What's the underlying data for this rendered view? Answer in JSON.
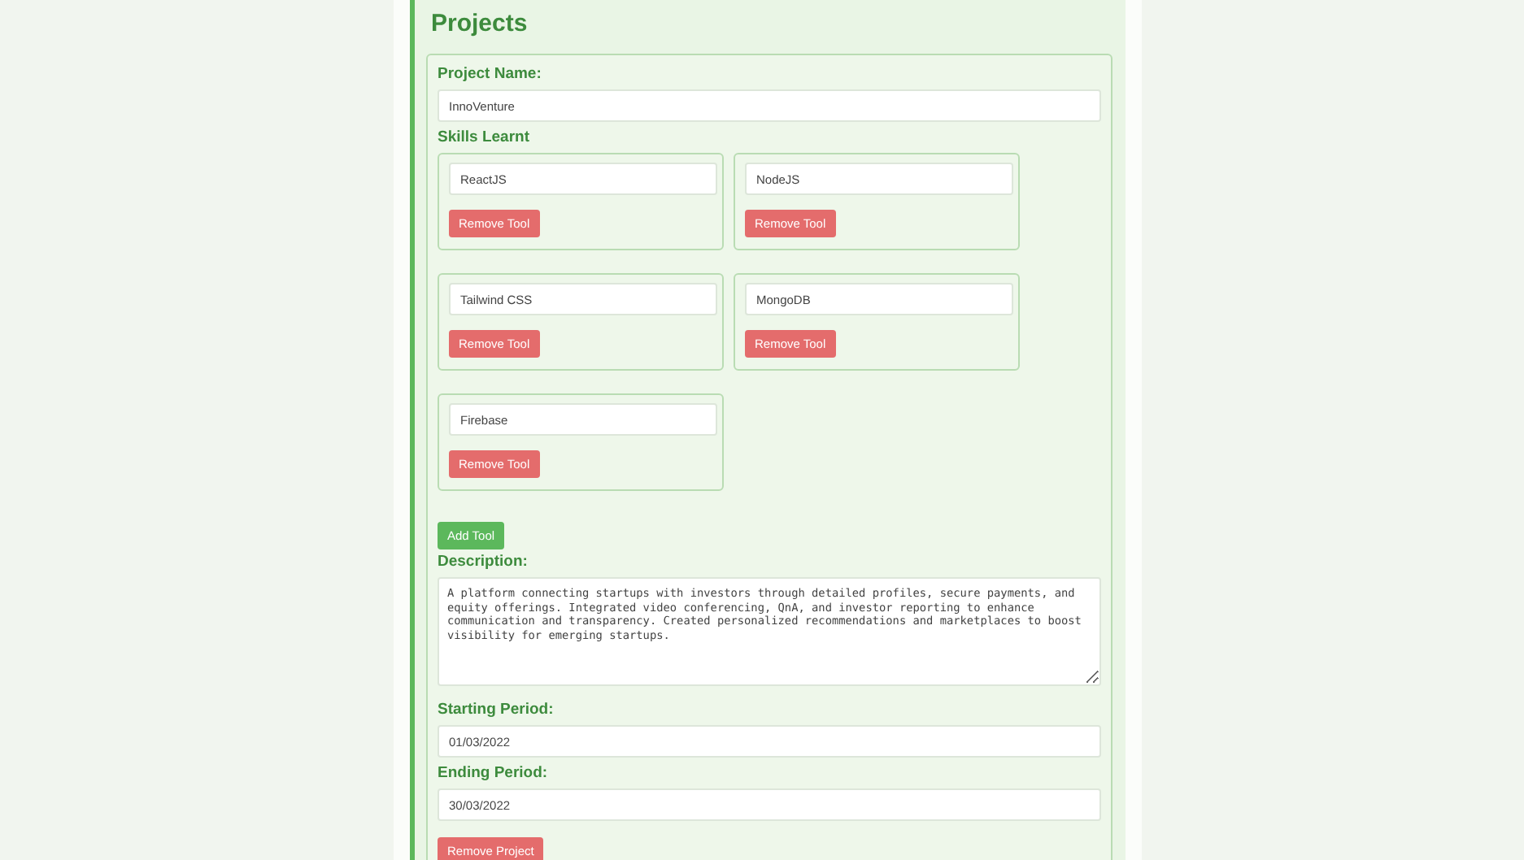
{
  "section": {
    "title": "Projects"
  },
  "project": {
    "name_label": "Project Name:",
    "name_value": "InnoVenture",
    "skills_label": "Skills Learnt",
    "tools": [
      {
        "value": "ReactJS",
        "remove_label": "Remove Tool"
      },
      {
        "value": "NodeJS",
        "remove_label": "Remove Tool"
      },
      {
        "value": "Tailwind CSS",
        "remove_label": "Remove Tool"
      },
      {
        "value": "MongoDB",
        "remove_label": "Remove Tool"
      },
      {
        "value": "Firebase",
        "remove_label": "Remove Tool"
      }
    ],
    "add_tool_label": "Add Tool",
    "description_label": "Description:",
    "description": "A platform connecting startups with investors through detailed profiles, secure payments, and equity offerings. Integrated video conferencing, QnA, and investor reporting to enhance communication and transparency. Created personalized recommendations and marketplaces to boost visibility for emerging startups.",
    "start_label": "Starting Period:",
    "start_value": "01/03/2022",
    "end_label": "Ending Period:",
    "end_value": "30/03/2022",
    "remove_project_label": "Remove Project"
  }
}
